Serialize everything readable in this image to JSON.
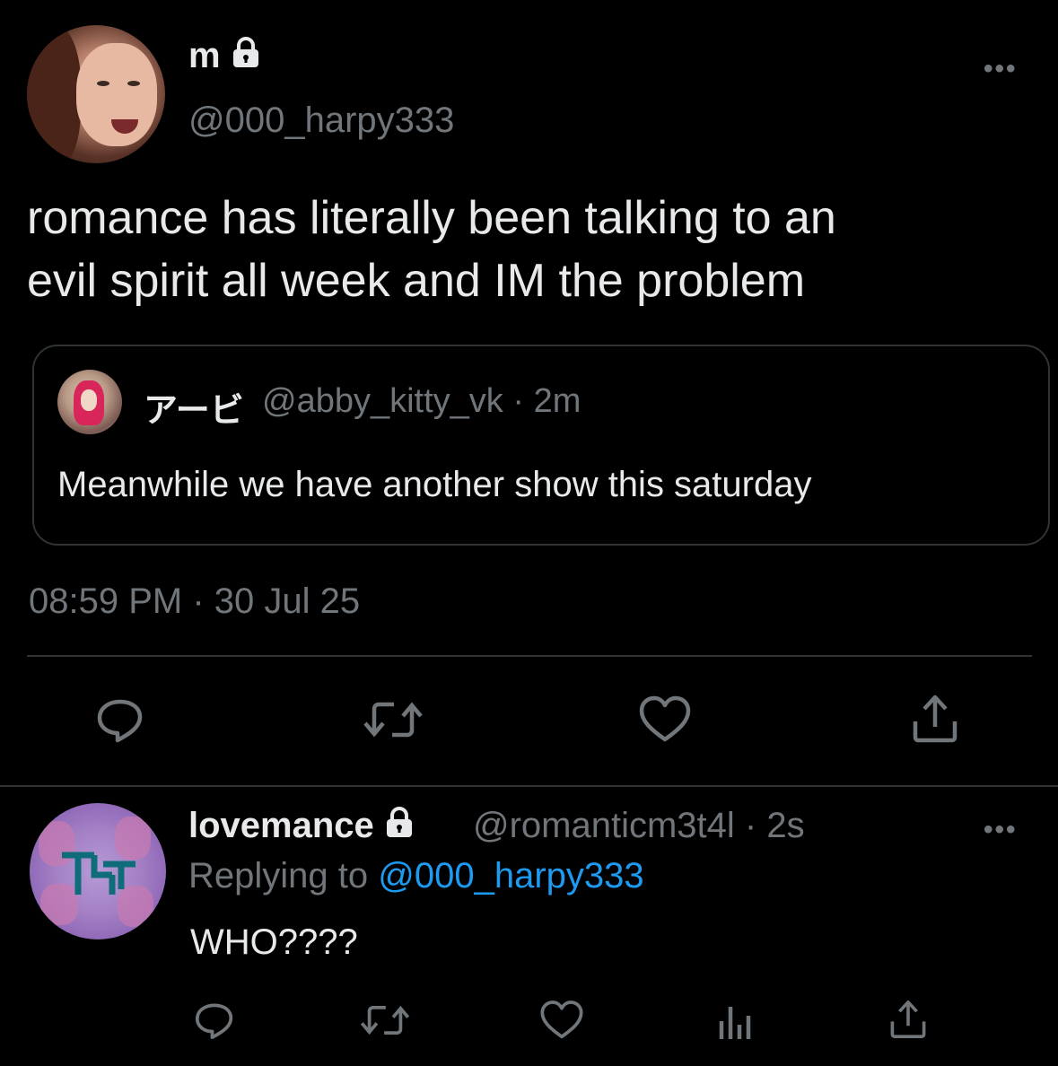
{
  "tweet": {
    "author": {
      "display_name": "m",
      "handle": "@000_harpy333"
    },
    "text_line1": "romance has literally been talking to an",
    "text_line2": "evil spirit all week and IM the problem",
    "quote": {
      "display_name": "アービ",
      "meta": "@abby_kitty_vk · 2m",
      "text": "Meanwhile we have another show this saturday"
    },
    "timestamp": "08:59 PM · 30 Jul 25",
    "actions": [
      "reply-icon",
      "retweet-icon",
      "like-icon",
      "share-icon"
    ]
  },
  "reply": {
    "author": {
      "display_name": "lovemance",
      "meta": "@romanticm3t4l · 2s"
    },
    "replying_prefix": "Replying to",
    "replying_mention": "@000_harpy333",
    "text": "WHO????",
    "actions": [
      "reply-icon",
      "retweet-icon",
      "like-icon",
      "views-icon",
      "share-icon"
    ]
  },
  "colors": {
    "background": "#000000",
    "text": "#e7e9ea",
    "muted": "#71767b",
    "link": "#1d9bf0",
    "border": "#2f3336"
  }
}
